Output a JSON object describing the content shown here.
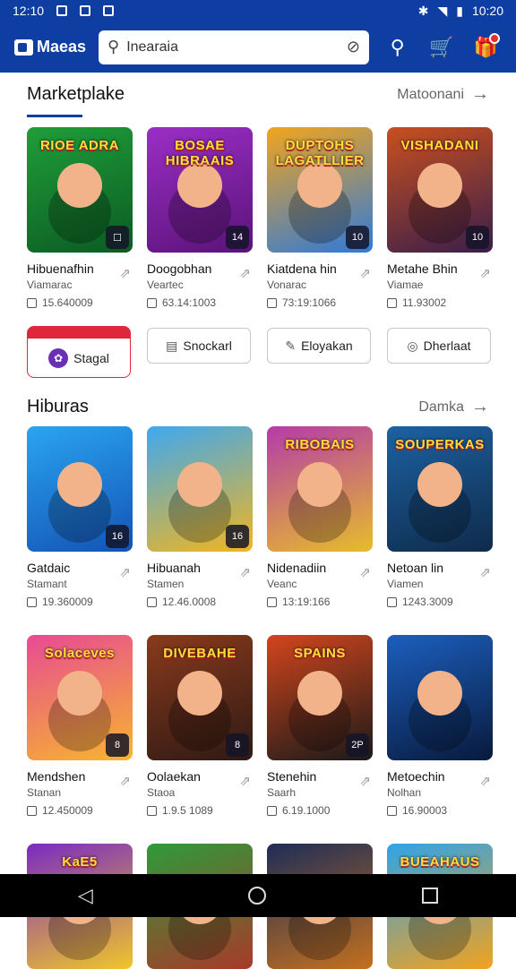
{
  "status": {
    "time_left": "12:10",
    "time_right": "10:20"
  },
  "header": {
    "logo": "Maeas",
    "search_value": "Inearaia"
  },
  "marketplace": {
    "title": "Marketplake",
    "see_all": "Matoonani"
  },
  "market_games": [
    {
      "thumb_title": "RIOE ADRA",
      "corner": "☐",
      "name": "Hibuenafhin",
      "sub": "Viamarac",
      "meta": "15.640009",
      "colors": [
        "#1f9e3a",
        "#0b5b22"
      ]
    },
    {
      "thumb_title": "BOSAE HIBRAAIS",
      "corner": "14",
      "name": "Doogobhan",
      "sub": "Veartec",
      "meta": "63.14:1003",
      "colors": [
        "#9b2ec6",
        "#5a1378"
      ]
    },
    {
      "thumb_title": "DUPTOHS LAGATLLIER",
      "corner": "10",
      "name": "Kiatdena hin",
      "sub": "Vonarac",
      "meta": "73:19:1066",
      "colors": [
        "#f2a51d",
        "#2f79d9"
      ]
    },
    {
      "thumb_title": "VISHADANI",
      "corner": "10",
      "name": "Metahe Bhin",
      "sub": "Viamae",
      "meta": "11.93002",
      "colors": [
        "#c9501e",
        "#3a1e4b"
      ]
    }
  ],
  "chips": [
    {
      "label": "Stagal",
      "icon": "✿"
    },
    {
      "label": "Snockarl",
      "icon": "▤"
    },
    {
      "label": "Eloyakan",
      "icon": "✎"
    },
    {
      "label": "Dherlaat",
      "icon": "◎"
    }
  ],
  "hiburas": {
    "title": "Hiburas",
    "see_all": "Damka"
  },
  "hiburas_games": [
    {
      "thumb_title": "",
      "corner": "16",
      "name": "Gatdaic",
      "sub": "Stamant",
      "meta": "19.360009",
      "colors": [
        "#2aa5ef",
        "#1353b5"
      ]
    },
    {
      "thumb_title": "",
      "corner": "16",
      "name": "Hibuanah",
      "sub": "Stamen",
      "meta": "12.46.0008",
      "colors": [
        "#3fa8f0",
        "#f2b61e"
      ]
    },
    {
      "thumb_title": "RIBOBAIS",
      "corner": "",
      "name": "Nidenadiin",
      "sub": "Veanc",
      "meta": "13:19:166",
      "colors": [
        "#b53aa9",
        "#e6bd2a"
      ]
    },
    {
      "thumb_title": "SOUPERKAS",
      "corner": "",
      "name": "Netoan lin",
      "sub": "Viamen",
      "meta": "1243.3009",
      "colors": [
        "#1c62a3",
        "#0f2a4a"
      ]
    },
    {
      "thumb_title": "Solaceves",
      "corner": "8",
      "name": "Mendshen",
      "sub": "Stanan",
      "meta": "12.450009",
      "colors": [
        "#e84a93",
        "#f7b52e"
      ]
    },
    {
      "thumb_title": "DIVEBAHE",
      "corner": "8",
      "name": "Oolaekan",
      "sub": "Staoa",
      "meta": "1.9.5 1089",
      "colors": [
        "#8a3a1c",
        "#2e1a14"
      ]
    },
    {
      "thumb_title": "SPAINS",
      "corner": "2P",
      "name": "Stenehin",
      "sub": "Saarh",
      "meta": "6.19.1000",
      "colors": [
        "#d2451c",
        "#1a1a1a"
      ]
    },
    {
      "thumb_title": "",
      "corner": "",
      "name": "Metoechin",
      "sub": "Nolhan",
      "meta": "16.90003",
      "colors": [
        "#1c5fbe",
        "#081a3d"
      ]
    },
    {
      "thumb_title": "KaE5",
      "corner": "",
      "name": "",
      "sub": "",
      "meta": "",
      "colors": [
        "#7a2ac2",
        "#f0c52a"
      ]
    },
    {
      "thumb_title": "",
      "corner": "",
      "name": "",
      "sub": "",
      "meta": "",
      "colors": [
        "#2e9a3a",
        "#a83a2a"
      ]
    },
    {
      "thumb_title": "",
      "corner": "",
      "name": "",
      "sub": "",
      "meta": "",
      "colors": [
        "#1e2d57",
        "#c4701e"
      ]
    },
    {
      "thumb_title": "BUEAHAUS",
      "corner": "",
      "name": "",
      "sub": "",
      "meta": "",
      "colors": [
        "#2fa3e8",
        "#f2a21e"
      ]
    }
  ]
}
